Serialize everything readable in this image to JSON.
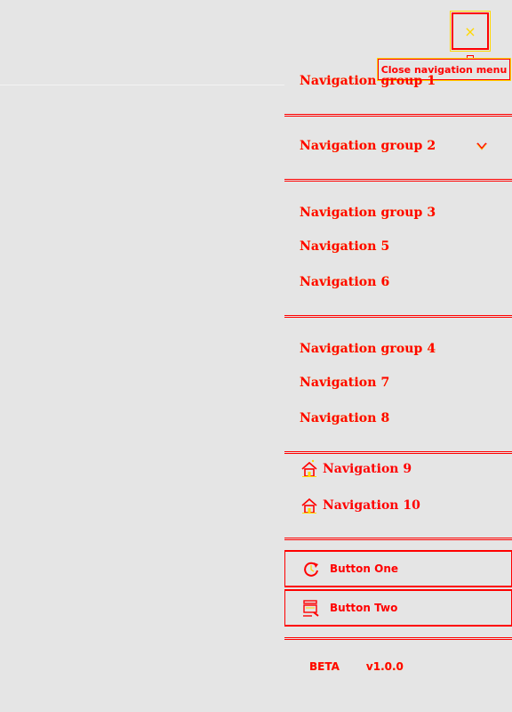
{
  "header": {
    "close_icon_glyph": "×",
    "close_tooltip": "Close navigation menu"
  },
  "nav": {
    "group1": {
      "label": "Navigation group 1"
    },
    "group2": {
      "label": "Navigation group 2"
    },
    "group3": {
      "label": "Navigation group 3",
      "items": [
        "Navigation 5",
        "Navigation 6"
      ]
    },
    "group4": {
      "label": "Navigation group 4",
      "items": [
        "Navigation 7",
        "Navigation 8"
      ]
    },
    "icon_links": [
      {
        "label": "Navigation 9",
        "icon": "home-icon"
      },
      {
        "label": "Navigation 10",
        "icon": "home-icon"
      }
    ]
  },
  "buttons": {
    "one": {
      "label": "Button One",
      "icon": "refresh-icon"
    },
    "two": {
      "label": "Button Two",
      "icon": "search-icon"
    }
  },
  "footer": {
    "badge": "BETA",
    "version": "v1.0.0"
  },
  "colors": {
    "accent": "#ff0000",
    "highlight": "#ffd800",
    "background": "#e5e5e5"
  }
}
